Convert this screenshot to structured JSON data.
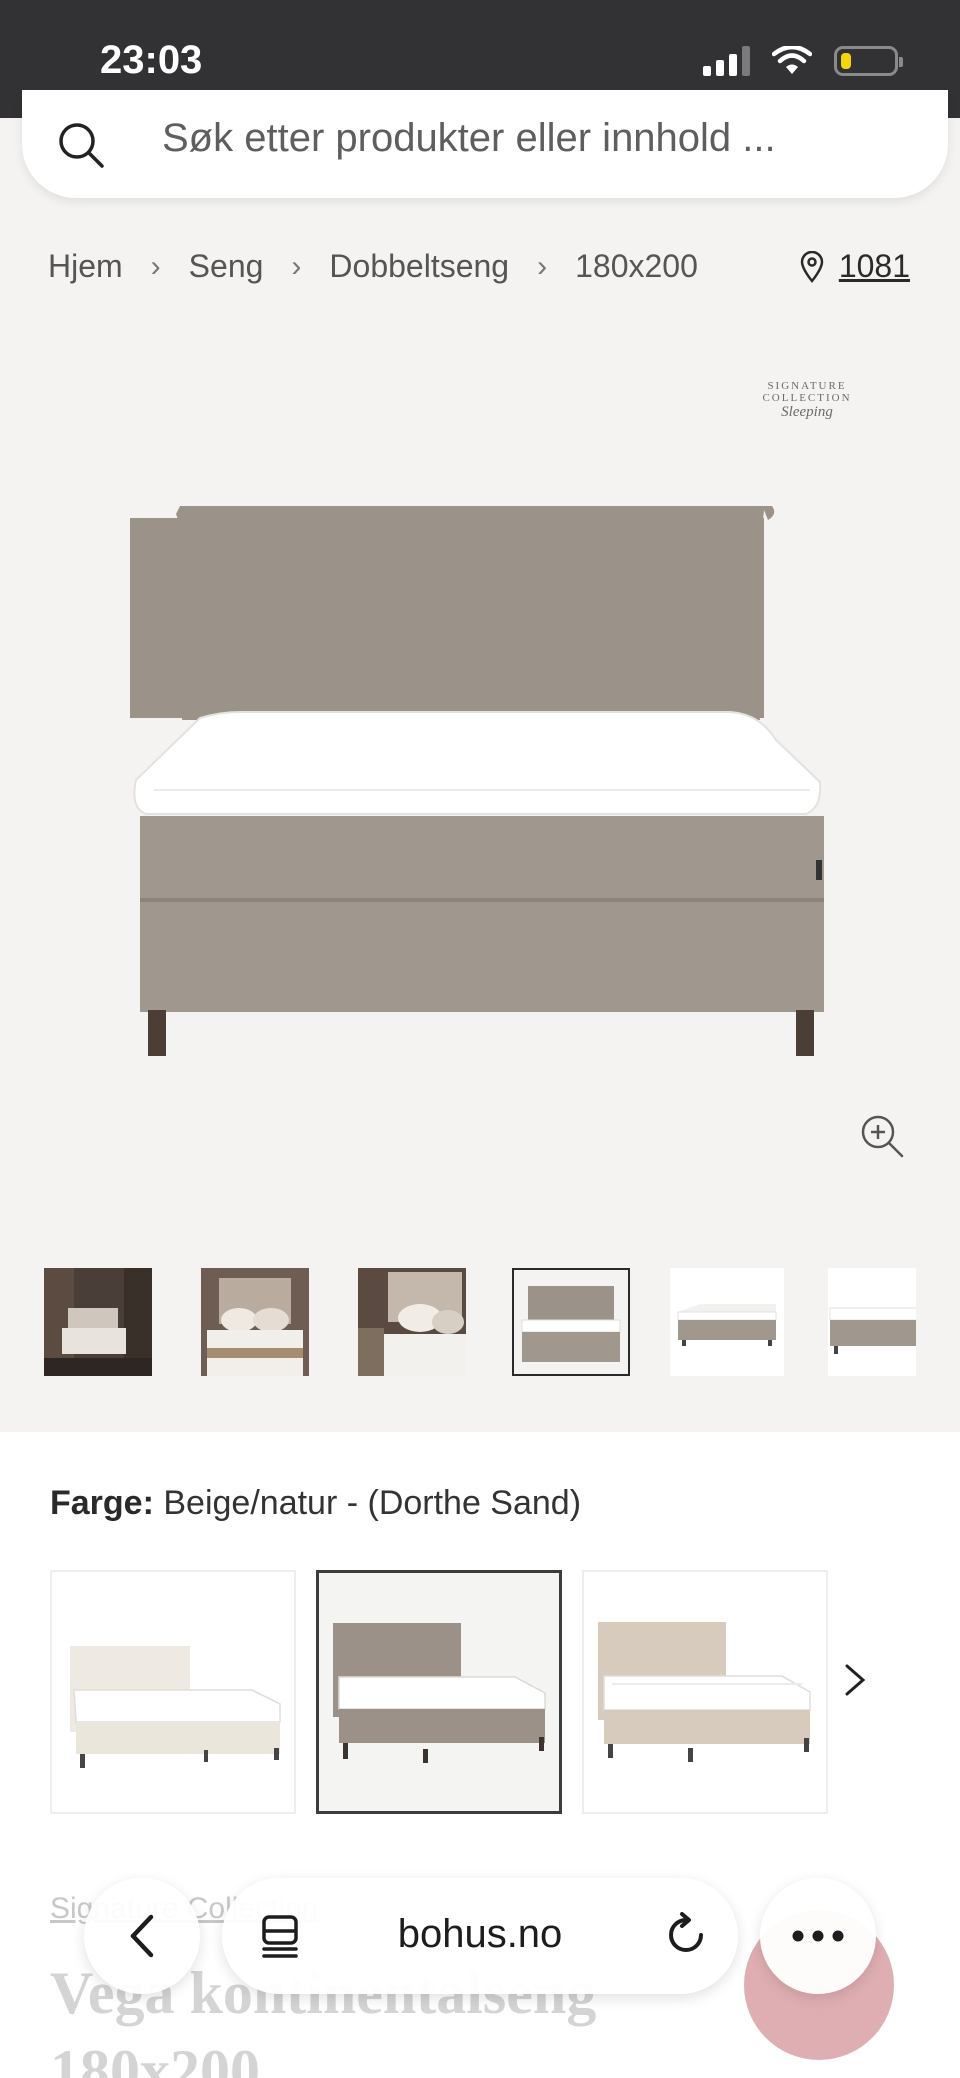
{
  "status_bar": {
    "time": "23:03",
    "battery_level": 0.2,
    "signal_bars": 3,
    "battery_color": "#f5d60d"
  },
  "search": {
    "placeholder": "Søk etter produkter eller innhold ..."
  },
  "breadcrumb": [
    {
      "label": "Hjem"
    },
    {
      "label": "Seng"
    },
    {
      "label": "Dobbeltseng"
    },
    {
      "label": "180x200"
    }
  ],
  "location": {
    "postcode": "1081"
  },
  "brand_mark": {
    "line1": "SIGNATURE COLLECTION",
    "line2": "Sleeping"
  },
  "gallery": {
    "active_index": 3,
    "thumbnails": [
      "lifestyle-bedroom-dark",
      "lifestyle-bed-pillows",
      "lifestyle-bed-closeup",
      "bed-front-view",
      "bed-base-only",
      "bed-base-side"
    ]
  },
  "color_selector": {
    "label": "Farge:",
    "value": "Beige/natur - (Dorthe Sand)",
    "variants": [
      {
        "name": "white",
        "color": "#ebe6dc"
      },
      {
        "name": "beige-natur",
        "color": "#9c9188"
      },
      {
        "name": "light-beige",
        "color": "#d6cbbd"
      }
    ],
    "active_index": 1
  },
  "product": {
    "brand_link": "Signature Collection",
    "title_line1": "Vega kontinentalseng",
    "title_line2": "180x200",
    "fabric_color": "#9b928a"
  },
  "browser": {
    "url": "bohus.no"
  }
}
